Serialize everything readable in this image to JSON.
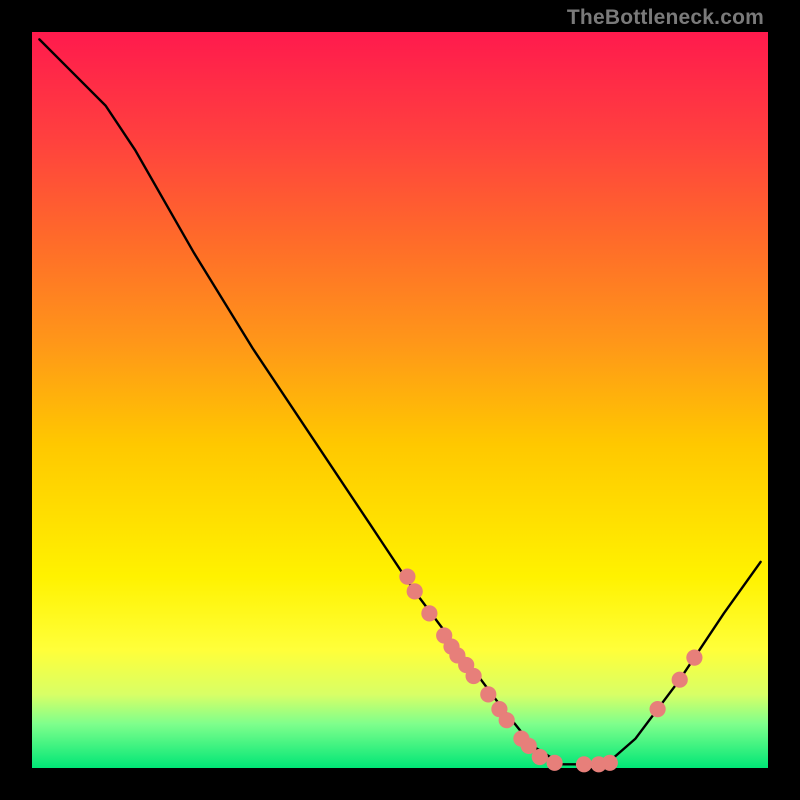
{
  "watermark": "TheBottleneck.com",
  "chart_data": {
    "type": "line",
    "title": "",
    "xlabel": "",
    "ylabel": "",
    "xlim": [
      0,
      100
    ],
    "ylim": [
      0,
      100
    ],
    "curve": {
      "name": "bottleneck-curve",
      "color": "#000000",
      "points": [
        {
          "x": 1,
          "y": 99
        },
        {
          "x": 5,
          "y": 95
        },
        {
          "x": 10,
          "y": 90
        },
        {
          "x": 14,
          "y": 84
        },
        {
          "x": 22,
          "y": 70
        },
        {
          "x": 30,
          "y": 57
        },
        {
          "x": 38,
          "y": 45
        },
        {
          "x": 46,
          "y": 33
        },
        {
          "x": 52,
          "y": 24
        },
        {
          "x": 58,
          "y": 16
        },
        {
          "x": 64,
          "y": 8
        },
        {
          "x": 68,
          "y": 3
        },
        {
          "x": 72,
          "y": 0.5
        },
        {
          "x": 76,
          "y": 0.5
        },
        {
          "x": 78,
          "y": 0.5
        },
        {
          "x": 82,
          "y": 4
        },
        {
          "x": 88,
          "y": 12
        },
        {
          "x": 94,
          "y": 21
        },
        {
          "x": 99,
          "y": 28
        }
      ]
    },
    "markers": {
      "name": "gpu-markers",
      "color": "#e77f7a",
      "radius_pct": 1.1,
      "points": [
        {
          "x": 51,
          "y": 26
        },
        {
          "x": 52,
          "y": 24
        },
        {
          "x": 54,
          "y": 21
        },
        {
          "x": 56,
          "y": 18
        },
        {
          "x": 57,
          "y": 16.5
        },
        {
          "x": 57.8,
          "y": 15.3
        },
        {
          "x": 59,
          "y": 14
        },
        {
          "x": 60,
          "y": 12.5
        },
        {
          "x": 62,
          "y": 10
        },
        {
          "x": 63.5,
          "y": 8
        },
        {
          "x": 64.5,
          "y": 6.5
        },
        {
          "x": 66.5,
          "y": 4
        },
        {
          "x": 67.5,
          "y": 3
        },
        {
          "x": 69,
          "y": 1.5
        },
        {
          "x": 71,
          "y": 0.7
        },
        {
          "x": 75,
          "y": 0.5
        },
        {
          "x": 77,
          "y": 0.5
        },
        {
          "x": 78.5,
          "y": 0.7
        },
        {
          "x": 85,
          "y": 8
        },
        {
          "x": 88,
          "y": 12
        },
        {
          "x": 90,
          "y": 15
        }
      ]
    }
  }
}
